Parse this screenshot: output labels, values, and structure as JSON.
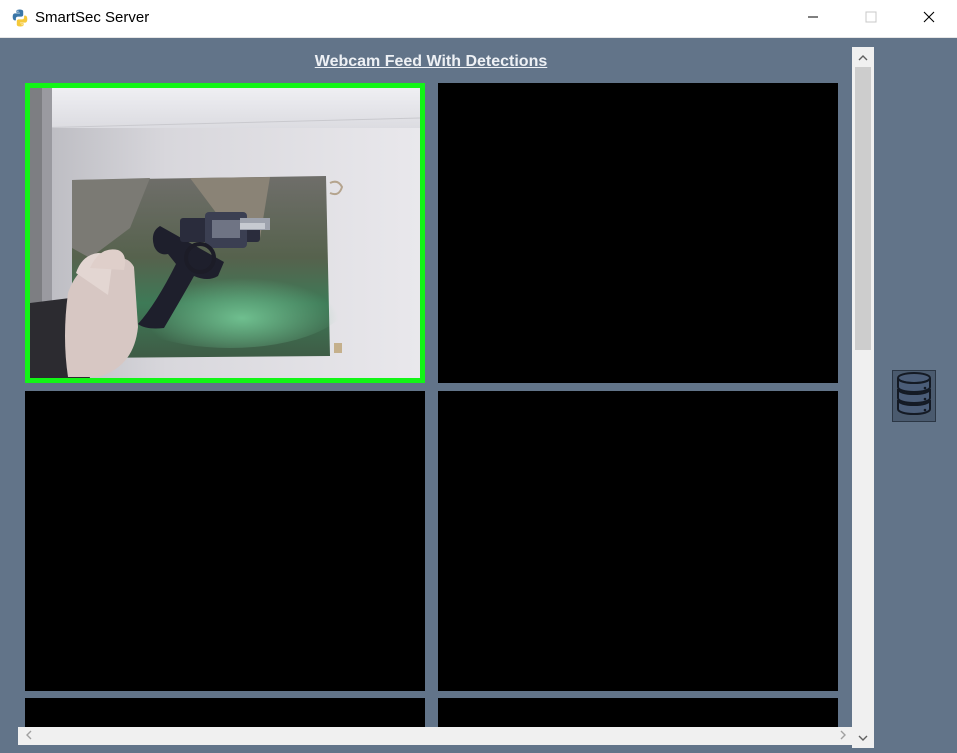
{
  "window": {
    "title": "SmartSec Server",
    "app_icon": "python-icon",
    "controls": [
      "minimize-icon",
      "maximize-icon",
      "close-icon"
    ]
  },
  "main": {
    "heading": "Webcam Feed With Detections",
    "feeds": [
      {
        "state": "detection",
        "content": "webcam frame with revolver",
        "highlight_color": "#12f516"
      },
      {
        "state": "empty"
      },
      {
        "state": "empty"
      },
      {
        "state": "empty"
      },
      {
        "state": "empty"
      },
      {
        "state": "empty"
      }
    ]
  },
  "sidebar": {
    "database_button_icon": "database-icon"
  },
  "colors": {
    "background": "#627489",
    "detection_border": "#12f516",
    "feed_empty": "#000000",
    "heading_text": "#eef1f5"
  },
  "scrollbars": {
    "vertical_icons": [
      "chevron-up-icon",
      "chevron-down-icon"
    ],
    "horizontal_icons": [
      "chevron-left-icon",
      "chevron-right-icon"
    ]
  }
}
